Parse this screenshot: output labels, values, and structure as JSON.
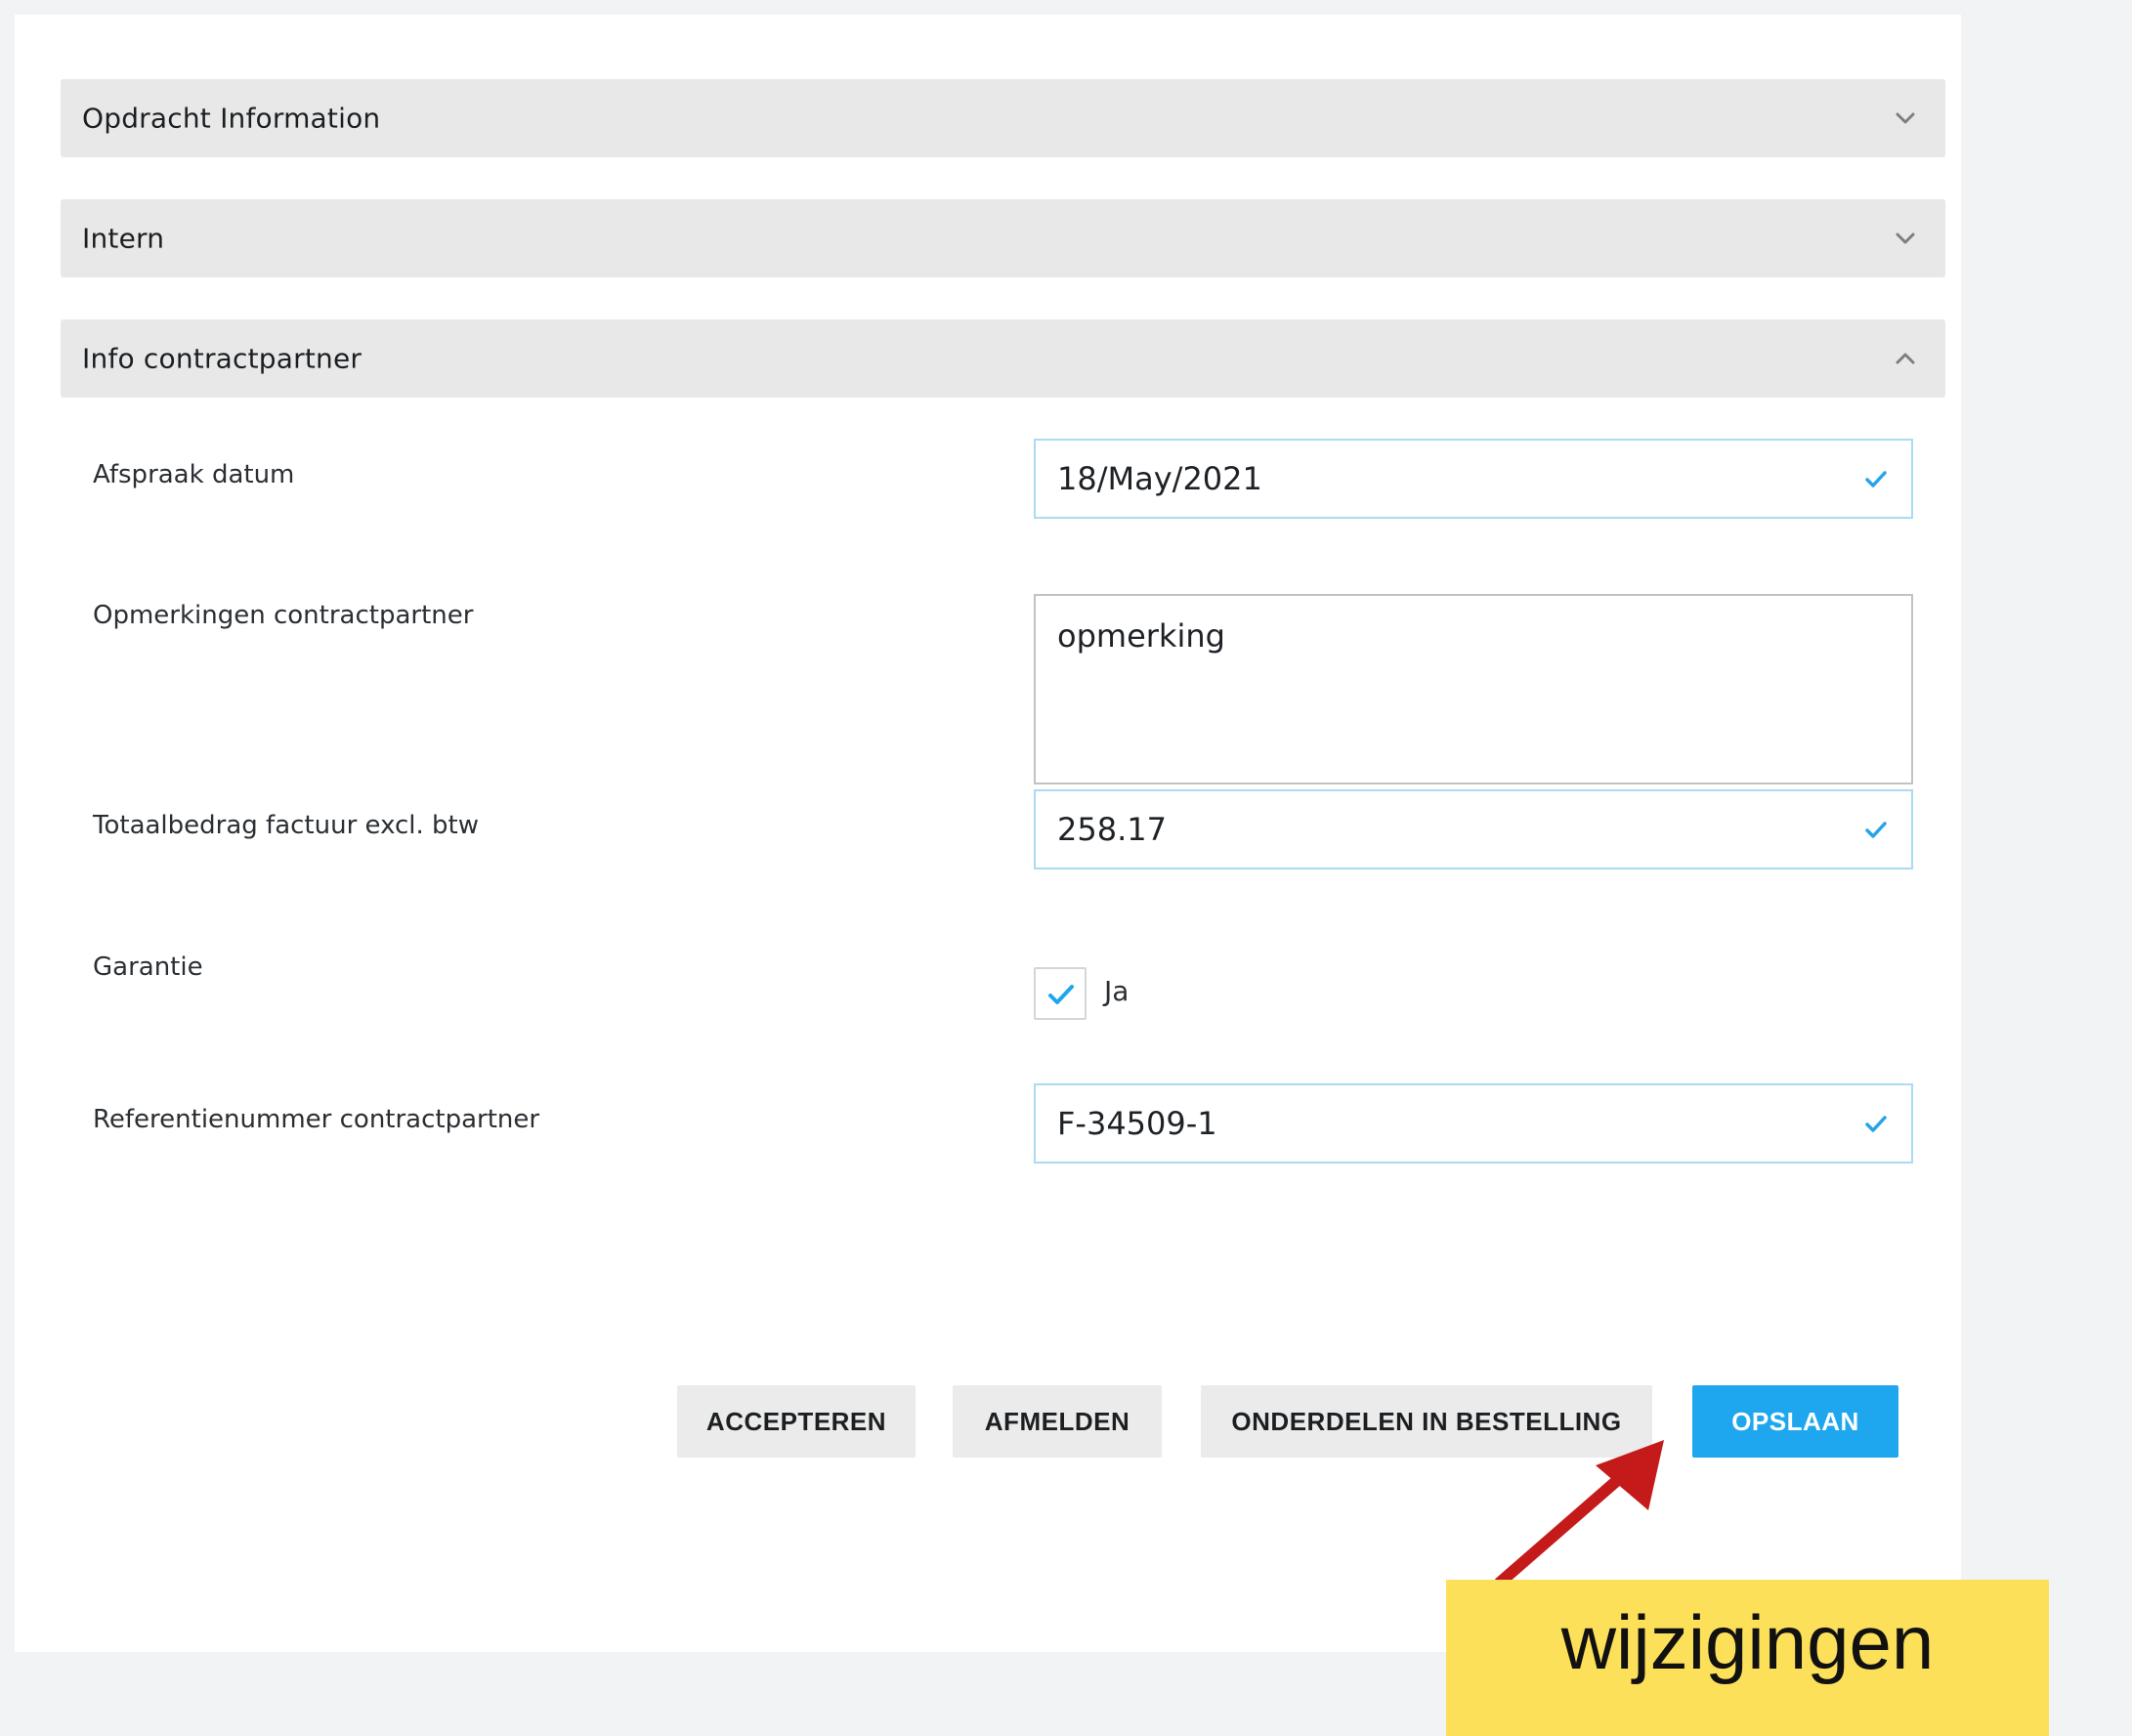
{
  "sections": [
    {
      "title": "Opdracht Information",
      "state": "collapsed",
      "icon": "chevron-down-icon"
    },
    {
      "title": "Intern",
      "state": "collapsed",
      "icon": "chevron-down-icon"
    },
    {
      "title": "Info contractpartner",
      "state": "expanded",
      "icon": "chevron-up-icon"
    }
  ],
  "form": {
    "afspraak_datum": {
      "label": "Afspraak datum",
      "value": "18/May/2021"
    },
    "opmerkingen": {
      "label": "Opmerkingen contractpartner",
      "value": "opmerking"
    },
    "totaalbedrag": {
      "label": "Totaalbedrag factuur excl. btw",
      "value": "258.17"
    },
    "garantie": {
      "label": "Garantie",
      "option_label": "Ja",
      "checked": true
    },
    "referentienummer": {
      "label": "Referentienummer contractpartner",
      "value": "F-34509-1"
    }
  },
  "actions": {
    "accepteren": "ACCEPTEREN",
    "afmelden": "AFMELDEN",
    "onderdelen": "ONDERDELEN IN BESTELLING",
    "opslaan": "OPSLAAN"
  },
  "annotation": {
    "text": "wijzigingen",
    "background": "#fde05a",
    "arrow_color": "#c41a1a"
  },
  "colors": {
    "accent": "#1ea7ee",
    "input_border_valid": "#a9dbf3",
    "section_header_bg": "#e8e8e8",
    "page_bg": "#f2f3f5"
  }
}
